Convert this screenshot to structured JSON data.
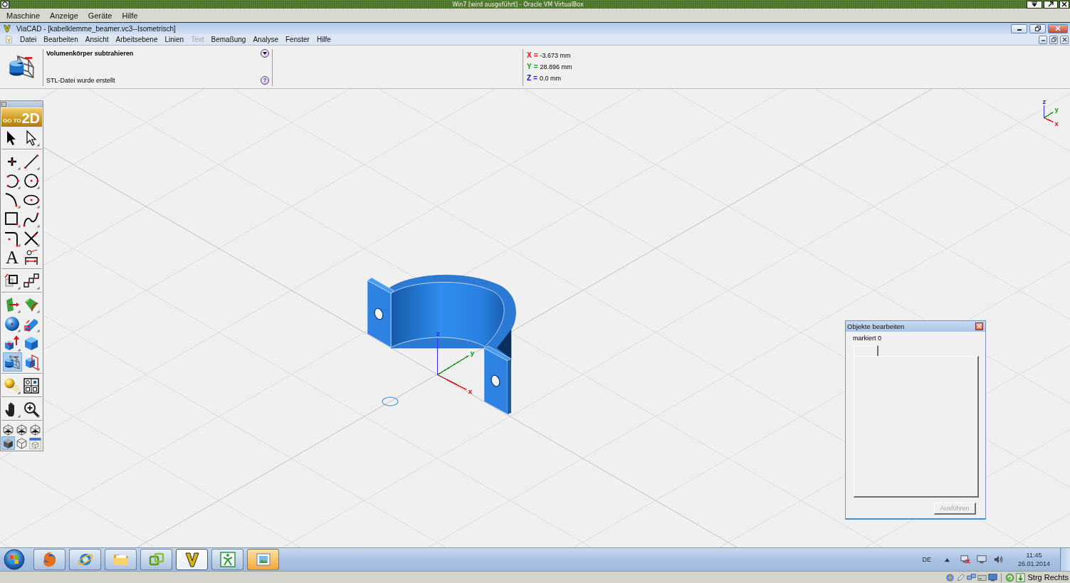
{
  "host_window": {
    "title": "Win7 [wird ausgeführt] - Oracle VM VirtualBox",
    "menu": [
      "Maschine",
      "Anzeige",
      "Geräte",
      "Hilfe"
    ]
  },
  "app_window": {
    "title": "ViaCAD - [kabelklemme_beamer.vc3--Isometrisch]",
    "menu": [
      {
        "label": "Datei",
        "disabled": false
      },
      {
        "label": "Bearbeiten",
        "disabled": false
      },
      {
        "label": "Ansicht",
        "disabled": false
      },
      {
        "label": "Arbeitsebene",
        "disabled": false
      },
      {
        "label": "Linien",
        "disabled": false
      },
      {
        "label": "Text",
        "disabled": true
      },
      {
        "label": "Bemaßung",
        "disabled": false
      },
      {
        "label": "Analyse",
        "disabled": false
      },
      {
        "label": "Fenster",
        "disabled": false
      },
      {
        "label": "Hilfe",
        "disabled": false
      }
    ]
  },
  "prompt": {
    "command": "Volumenkörper subtrahieren",
    "message": "STL-Datei wurde erstellt",
    "help": "?"
  },
  "coordinates": [
    {
      "axis": "X",
      "sign": "=",
      "value": "-3.673 mm",
      "color": "#e81010"
    },
    {
      "axis": "Y",
      "sign": "=",
      "value": "28.896 mm",
      "color": "#10a010"
    },
    {
      "axis": "Z",
      "sign": "=",
      "value": "0.0 mm",
      "color": "#1010f0"
    }
  ],
  "toolbar": {
    "banner": {
      "small": "GO TO",
      "large": "2D"
    },
    "groups": [
      {
        "kind": "tools",
        "tools": [
          {
            "kind": "arrow",
            "selected": false
          },
          {
            "kind": "pointer",
            "selected": false
          }
        ]
      },
      {
        "kind": "tools",
        "tools": [
          {
            "kind": "point",
            "selected": false
          },
          {
            "kind": "line",
            "selected": false
          },
          {
            "kind": "arc",
            "selected": false
          },
          {
            "kind": "circle",
            "selected": false
          },
          {
            "kind": "curve",
            "selected": false
          },
          {
            "kind": "ellipse",
            "selected": false
          },
          {
            "kind": "rectangle",
            "selected": false
          },
          {
            "kind": "spline",
            "selected": false
          },
          {
            "kind": "fillet",
            "selected": false
          },
          {
            "kind": "trim",
            "selected": false
          },
          {
            "kind": "text",
            "glyph": "A",
            "selected": false
          },
          {
            "kind": "dimension",
            "selected": false
          }
        ]
      },
      {
        "kind": "tools",
        "tools": [
          {
            "kind": "scale",
            "selected": false
          },
          {
            "kind": "copy",
            "selected": false
          }
        ]
      },
      {
        "kind": "tools",
        "tools": [
          {
            "kind": "surface",
            "selected": false
          },
          {
            "kind": "loft",
            "selected": false
          },
          {
            "kind": "sphere",
            "selected": false
          },
          {
            "kind": "block",
            "selected": false
          },
          {
            "kind": "add",
            "selected": false
          },
          {
            "kind": "cube",
            "selected": false
          },
          {
            "kind": "subtract",
            "selected": true
          },
          {
            "kind": "slice",
            "selected": false
          }
        ]
      },
      {
        "kind": "tools",
        "tools": [
          {
            "kind": "render",
            "selected": false
          },
          {
            "kind": "layout",
            "selected": false
          }
        ]
      },
      {
        "kind": "tools",
        "tools": [
          {
            "kind": "pan",
            "selected": false
          },
          {
            "kind": "zoom",
            "selected": false
          }
        ]
      },
      {
        "kind": "views",
        "tools": [
          {
            "kind": "wireframe",
            "selected": false
          },
          {
            "kind": "wireframe",
            "selected": false
          },
          {
            "kind": "wireframe",
            "selected": false
          },
          {
            "kind": "shaded",
            "selected": true
          },
          {
            "kind": "outline",
            "selected": false
          },
          {
            "kind": "viewport",
            "selected": false
          }
        ]
      }
    ]
  },
  "viewport": {
    "origin_axes": [
      {
        "label": "z",
        "color": "#3030ff"
      },
      {
        "label": "y",
        "color": "#20a020"
      },
      {
        "label": "x",
        "color": "#e02020"
      }
    ],
    "view_triad": [
      {
        "label": "z",
        "color": "#3030ff"
      },
      {
        "label": "y",
        "color": "#20a020"
      },
      {
        "label": "x",
        "color": "#e02020"
      }
    ]
  },
  "dialog": {
    "title": "Objekte bearbeiten",
    "label": "markiert 0",
    "button": {
      "label": "Ausführen",
      "disabled": true
    }
  },
  "taskbar": {
    "apps": [
      {
        "kind": "fox",
        "selected": false,
        "flashing": false
      },
      {
        "kind": "ring",
        "selected": false,
        "flashing": false
      },
      {
        "kind": "folder",
        "selected": false,
        "flashing": false
      },
      {
        "kind": "squares",
        "selected": false,
        "flashing": false
      },
      {
        "kind": "chevron",
        "selected": true,
        "flashing": false
      },
      {
        "kind": "figure",
        "selected": false,
        "flashing": false
      },
      {
        "kind": "picture",
        "selected": false,
        "flashing": true
      }
    ],
    "language": "DE",
    "time": "11:45",
    "date": "26.01.2014"
  },
  "status_bar": {
    "host_key": "Strg Rechts"
  }
}
